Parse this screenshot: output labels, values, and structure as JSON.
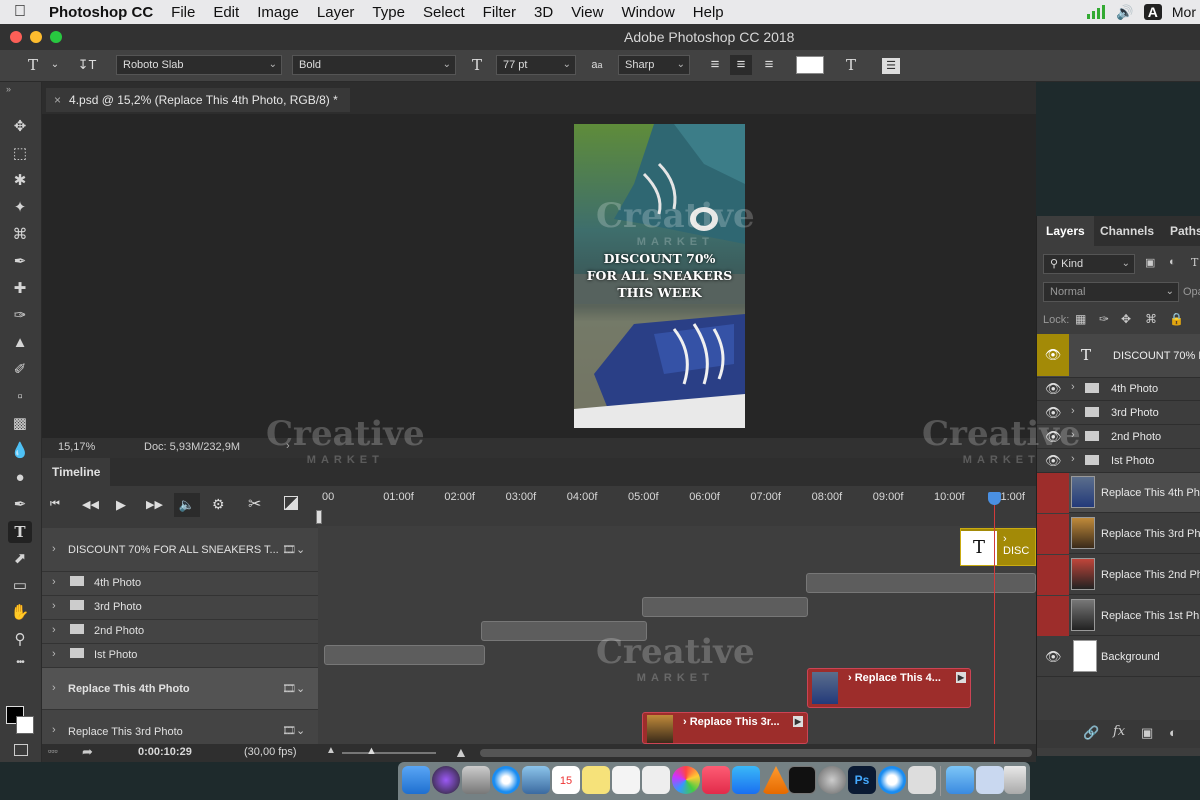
{
  "menubar": {
    "apple_icon": "apple-logo-icon",
    "items": [
      "Photoshop CC",
      "File",
      "Edit",
      "Image",
      "Layer",
      "Type",
      "Select",
      "Filter",
      "3D",
      "View",
      "Window",
      "Help"
    ],
    "input_source": "A",
    "user": "Mor"
  },
  "window": {
    "title": "Adobe Photoshop CC 2018"
  },
  "options": {
    "font_family": "Roboto Slab",
    "font_style": "Bold",
    "font_size": "77 pt",
    "aa_label": "a",
    "antialias": "Sharp",
    "text_color": "#ffffff"
  },
  "document": {
    "tab_title": "4.psd @ 15,2% (Replace This 4th Photo, RGB/8) *",
    "close_glyph": "×",
    "zoom": "15,17%",
    "doc_info": "Doc: 5,93M/232,9M",
    "artwork_lines": [
      "DISCOUNT 70%",
      "FOR ALL SNEAKERS",
      "THIS WEEK"
    ]
  },
  "timeline": {
    "title": "Timeline",
    "ruler_labels": [
      "00",
      "01:00f",
      "02:00f",
      "03:00f",
      "04:00f",
      "05:00f",
      "06:00f",
      "07:00f",
      "08:00f",
      "09:00f",
      "10:00f",
      "11:00f"
    ],
    "tracks": [
      {
        "label": "DISCOUNT 70% FOR ALL SNEAKERS T...",
        "type": "text"
      },
      {
        "label": "4th Photo",
        "type": "folder"
      },
      {
        "label": "3rd Photo",
        "type": "folder"
      },
      {
        "label": "2nd Photo",
        "type": "folder"
      },
      {
        "label": "Ist Photo",
        "type": "folder"
      },
      {
        "label": "Replace This 4th Photo",
        "type": "video"
      },
      {
        "label": "Replace This 3rd Photo",
        "type": "video"
      }
    ],
    "clip_text_label": "DISC",
    "clip_text_glyph": "T",
    "clip_4th_label": "Replace This 4...",
    "clip_3rd_label": "Replace This 3r...",
    "timecode": "0:00:10:29",
    "fps": "(30,00 fps)"
  },
  "layers_panel": {
    "tabs": [
      "Layers",
      "Channels",
      "Paths"
    ],
    "filter_label": "Kind",
    "blend_mode": "Normal",
    "opacity_label": "Opa",
    "lock_label": "Lock:",
    "layers": [
      {
        "name": "DISCOUNT 70% F",
        "kind": "text"
      },
      {
        "name": "4th Photo",
        "kind": "group"
      },
      {
        "name": "3rd Photo",
        "kind": "group"
      },
      {
        "name": "2nd Photo",
        "kind": "group"
      },
      {
        "name": "Ist Photo",
        "kind": "group"
      },
      {
        "name": "Replace This 4th Ph",
        "kind": "smart"
      },
      {
        "name": "Replace This 3rd Ph",
        "kind": "smart"
      },
      {
        "name": "Replace This 2nd Ph",
        "kind": "smart"
      },
      {
        "name": "Replace This 1st Ph",
        "kind": "smart"
      },
      {
        "name": "Background",
        "kind": "pixel"
      }
    ]
  },
  "watermark": {
    "word": "Creative",
    "sub": "MARKET"
  },
  "colors": {
    "accent_yellow": "#a38a07",
    "clip_red": "#9d2d2b",
    "playhead": "#d23b3b"
  }
}
